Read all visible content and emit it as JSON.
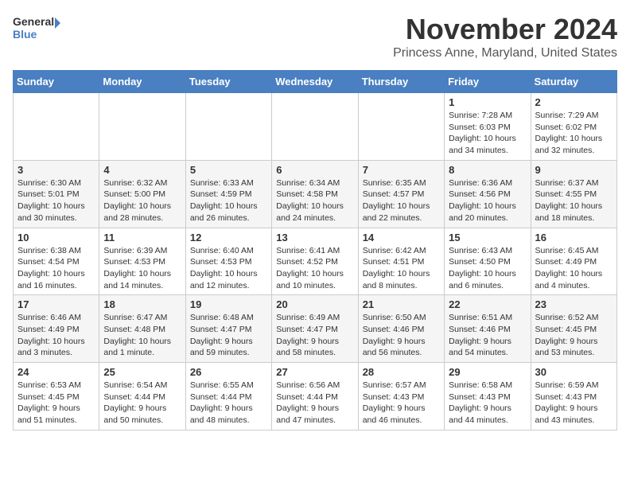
{
  "logo": {
    "text_general": "General",
    "text_blue": "Blue"
  },
  "title": {
    "month": "November 2024",
    "location": "Princess Anne, Maryland, United States"
  },
  "calendar": {
    "headers": [
      "Sunday",
      "Monday",
      "Tuesday",
      "Wednesday",
      "Thursday",
      "Friday",
      "Saturday"
    ],
    "weeks": [
      [
        {
          "day": "",
          "info": ""
        },
        {
          "day": "",
          "info": ""
        },
        {
          "day": "",
          "info": ""
        },
        {
          "day": "",
          "info": ""
        },
        {
          "day": "",
          "info": ""
        },
        {
          "day": "1",
          "info": "Sunrise: 7:28 AM\nSunset: 6:03 PM\nDaylight: 10 hours\nand 34 minutes."
        },
        {
          "day": "2",
          "info": "Sunrise: 7:29 AM\nSunset: 6:02 PM\nDaylight: 10 hours\nand 32 minutes."
        }
      ],
      [
        {
          "day": "3",
          "info": "Sunrise: 6:30 AM\nSunset: 5:01 PM\nDaylight: 10 hours\nand 30 minutes."
        },
        {
          "day": "4",
          "info": "Sunrise: 6:32 AM\nSunset: 5:00 PM\nDaylight: 10 hours\nand 28 minutes."
        },
        {
          "day": "5",
          "info": "Sunrise: 6:33 AM\nSunset: 4:59 PM\nDaylight: 10 hours\nand 26 minutes."
        },
        {
          "day": "6",
          "info": "Sunrise: 6:34 AM\nSunset: 4:58 PM\nDaylight: 10 hours\nand 24 minutes."
        },
        {
          "day": "7",
          "info": "Sunrise: 6:35 AM\nSunset: 4:57 PM\nDaylight: 10 hours\nand 22 minutes."
        },
        {
          "day": "8",
          "info": "Sunrise: 6:36 AM\nSunset: 4:56 PM\nDaylight: 10 hours\nand 20 minutes."
        },
        {
          "day": "9",
          "info": "Sunrise: 6:37 AM\nSunset: 4:55 PM\nDaylight: 10 hours\nand 18 minutes."
        }
      ],
      [
        {
          "day": "10",
          "info": "Sunrise: 6:38 AM\nSunset: 4:54 PM\nDaylight: 10 hours\nand 16 minutes."
        },
        {
          "day": "11",
          "info": "Sunrise: 6:39 AM\nSunset: 4:53 PM\nDaylight: 10 hours\nand 14 minutes."
        },
        {
          "day": "12",
          "info": "Sunrise: 6:40 AM\nSunset: 4:53 PM\nDaylight: 10 hours\nand 12 minutes."
        },
        {
          "day": "13",
          "info": "Sunrise: 6:41 AM\nSunset: 4:52 PM\nDaylight: 10 hours\nand 10 minutes."
        },
        {
          "day": "14",
          "info": "Sunrise: 6:42 AM\nSunset: 4:51 PM\nDaylight: 10 hours\nand 8 minutes."
        },
        {
          "day": "15",
          "info": "Sunrise: 6:43 AM\nSunset: 4:50 PM\nDaylight: 10 hours\nand 6 minutes."
        },
        {
          "day": "16",
          "info": "Sunrise: 6:45 AM\nSunset: 4:49 PM\nDaylight: 10 hours\nand 4 minutes."
        }
      ],
      [
        {
          "day": "17",
          "info": "Sunrise: 6:46 AM\nSunset: 4:49 PM\nDaylight: 10 hours\nand 3 minutes."
        },
        {
          "day": "18",
          "info": "Sunrise: 6:47 AM\nSunset: 4:48 PM\nDaylight: 10 hours\nand 1 minute."
        },
        {
          "day": "19",
          "info": "Sunrise: 6:48 AM\nSunset: 4:47 PM\nDaylight: 9 hours\nand 59 minutes."
        },
        {
          "day": "20",
          "info": "Sunrise: 6:49 AM\nSunset: 4:47 PM\nDaylight: 9 hours\nand 58 minutes."
        },
        {
          "day": "21",
          "info": "Sunrise: 6:50 AM\nSunset: 4:46 PM\nDaylight: 9 hours\nand 56 minutes."
        },
        {
          "day": "22",
          "info": "Sunrise: 6:51 AM\nSunset: 4:46 PM\nDaylight: 9 hours\nand 54 minutes."
        },
        {
          "day": "23",
          "info": "Sunrise: 6:52 AM\nSunset: 4:45 PM\nDaylight: 9 hours\nand 53 minutes."
        }
      ],
      [
        {
          "day": "24",
          "info": "Sunrise: 6:53 AM\nSunset: 4:45 PM\nDaylight: 9 hours\nand 51 minutes."
        },
        {
          "day": "25",
          "info": "Sunrise: 6:54 AM\nSunset: 4:44 PM\nDaylight: 9 hours\nand 50 minutes."
        },
        {
          "day": "26",
          "info": "Sunrise: 6:55 AM\nSunset: 4:44 PM\nDaylight: 9 hours\nand 48 minutes."
        },
        {
          "day": "27",
          "info": "Sunrise: 6:56 AM\nSunset: 4:44 PM\nDaylight: 9 hours\nand 47 minutes."
        },
        {
          "day": "28",
          "info": "Sunrise: 6:57 AM\nSunset: 4:43 PM\nDaylight: 9 hours\nand 46 minutes."
        },
        {
          "day": "29",
          "info": "Sunrise: 6:58 AM\nSunset: 4:43 PM\nDaylight: 9 hours\nand 44 minutes."
        },
        {
          "day": "30",
          "info": "Sunrise: 6:59 AM\nSunset: 4:43 PM\nDaylight: 9 hours\nand 43 minutes."
        }
      ]
    ]
  }
}
